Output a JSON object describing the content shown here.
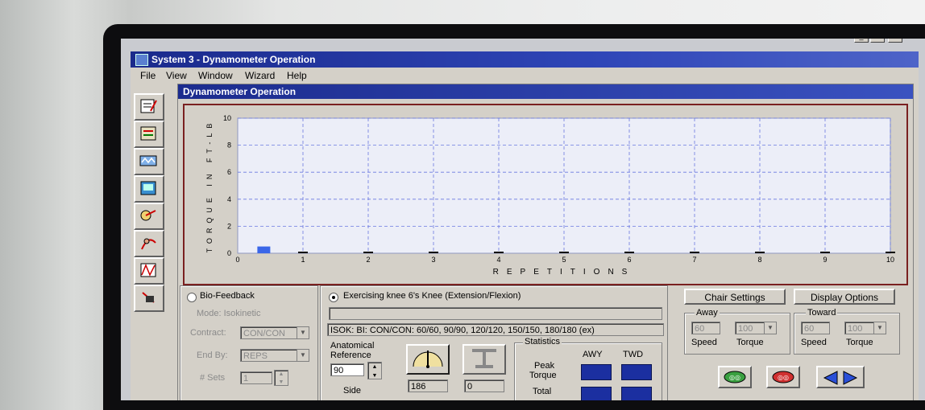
{
  "window": {
    "title": "System 3 - Dynamometer Operation",
    "min_label": "_",
    "max_label": "□",
    "close_label": "×"
  },
  "menu": [
    "File",
    "View",
    "Window",
    "Wizard",
    "Help"
  ],
  "child_window": {
    "title": "Dynamometer Operation"
  },
  "toolbar_icons": [
    "notes-icon",
    "settings-icon",
    "waveform-icon",
    "monitor-icon",
    "calibrate-icon",
    "patient-icon",
    "graph-icon",
    "exit-icon"
  ],
  "chart_data": {
    "type": "bar",
    "ylabel": "TORQUE IN FT-LB",
    "xlabel": "REPETITIONS",
    "x_ticks": [
      "0",
      "1",
      "2",
      "3",
      "4",
      "5",
      "6",
      "7",
      "8",
      "9",
      "10"
    ],
    "y_ticks": [
      "0",
      "2",
      "4",
      "6",
      "8",
      "10"
    ],
    "xlim": [
      0,
      10
    ],
    "ylim": [
      0,
      10
    ],
    "bar_x": 0.4,
    "bar_value": 0.5,
    "bar_color": "#3a66e8",
    "grid": true
  },
  "left_panel": {
    "biofeedback_label": "Bio-Feedback",
    "mode_label": "Mode: Isokinetic",
    "contract_label": "Contract:",
    "contract_value": "CON/CON",
    "end_by_label": "End By:",
    "end_by_value": "REPS",
    "sets_label": "# Sets",
    "sets_value": "1"
  },
  "exercise_panel": {
    "exercising_label": "Exercising  knee 6's Knee (Extension/Flexion)",
    "protocol_text": "ISOK: BI: CON/CON: 60/60, 90/90, 120/120, 150/150, 180/180 (ex)",
    "anatomical_label_1": "Anatomical",
    "anatomical_label_2": "Reference",
    "anatomical_value": "90",
    "side_label": "Side",
    "field_1": "186",
    "field_2": "0"
  },
  "statistics": {
    "title": "Statistics",
    "col_awy": "AWY",
    "col_twd": "TWD",
    "peak_label_1": "Peak",
    "peak_label_2": "Torque",
    "total_label": "Total"
  },
  "right_panel": {
    "chair_settings": "Chair Settings",
    "display_options": "Display Options",
    "away_title": "Away",
    "away_speed": "60",
    "away_torque": "100",
    "toward_title": "Toward",
    "toward_speed": "60",
    "toward_torque": "100",
    "speed_label": "Speed",
    "torque_label": "Torque"
  }
}
